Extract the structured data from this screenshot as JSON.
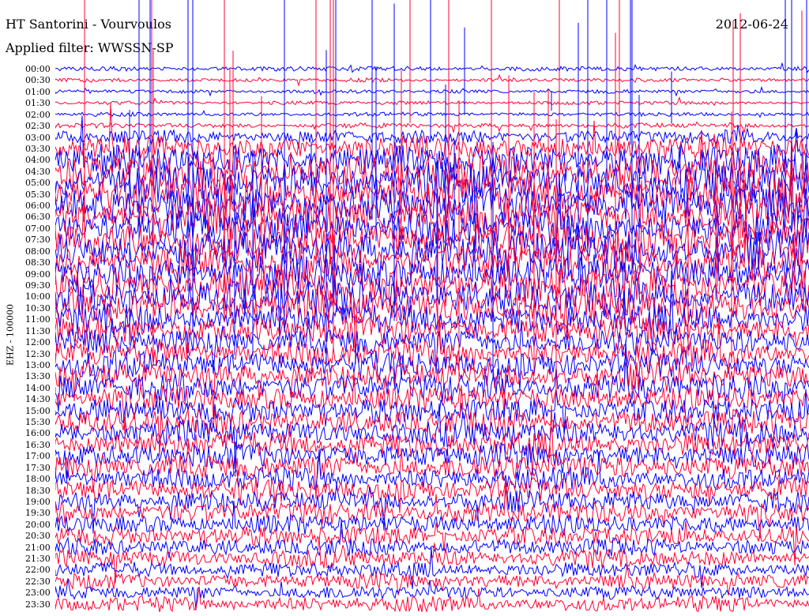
{
  "header": {
    "station": "HT Santorini - Vourvoulos",
    "date": "2012-06-24",
    "filter": "Applied filter: WWSSN-SP"
  },
  "colors": {
    "trace_a": "#0000ff",
    "trace_b": "#ff0033",
    "background": "#ffffff"
  },
  "chart_data": {
    "type": "line",
    "title": "HT Santorini - Vourvoulos",
    "date": "2012-06-24",
    "ylabel": "EHZ - 100000",
    "xlabel": "",
    "row_labels": [
      "00:00",
      "00:30",
      "01:00",
      "01:30",
      "02:00",
      "02:30",
      "03:00",
      "03:30",
      "04:00",
      "04:30",
      "05:00",
      "05:30",
      "06:00",
      "06:30",
      "07:00",
      "07:30",
      "08:00",
      "08:30",
      "09:00",
      "09:30",
      "10:00",
      "10:30",
      "11:00",
      "11:30",
      "12:00",
      "12:30",
      "13:00",
      "13:30",
      "14:00",
      "14:30",
      "15:00",
      "15:30",
      "16:00",
      "16:30",
      "17:00",
      "17:30",
      "18:00",
      "18:30",
      "19:00",
      "19:30",
      "20:00",
      "20:30",
      "21:00",
      "21:30",
      "22:00",
      "22:30",
      "23:00",
      "23:30"
    ],
    "series": [
      {
        "color": "#0000ff",
        "rows": [
          0,
          2,
          4,
          6,
          8,
          10,
          12,
          14,
          16,
          18,
          20,
          22,
          24,
          26,
          28,
          30,
          32,
          34,
          36,
          38,
          40,
          42,
          44,
          46
        ]
      },
      {
        "color": "#ff0033",
        "rows": [
          1,
          3,
          5,
          7,
          9,
          11,
          13,
          15,
          17,
          19,
          21,
          23,
          25,
          27,
          29,
          31,
          33,
          35,
          37,
          39,
          41,
          43,
          45,
          47
        ]
      }
    ],
    "row_amplitude": [
      0.25,
      0.2,
      0.2,
      0.2,
      0.2,
      0.25,
      0.7,
      1.2,
      1.6,
      1.8,
      2.0,
      2.0,
      2.0,
      2.0,
      2.0,
      2.0,
      2.0,
      1.9,
      1.8,
      1.8,
      1.8,
      1.8,
      1.6,
      1.5,
      1.4,
      1.4,
      1.4,
      1.4,
      1.4,
      1.3,
      1.3,
      1.3,
      1.3,
      1.3,
      1.3,
      1.3,
      1.2,
      1.2,
      1.1,
      1.1,
      1.0,
      1.0,
      0.9,
      0.9,
      0.8,
      0.8,
      0.7,
      0.8
    ],
    "grid": false,
    "legend": "none"
  }
}
